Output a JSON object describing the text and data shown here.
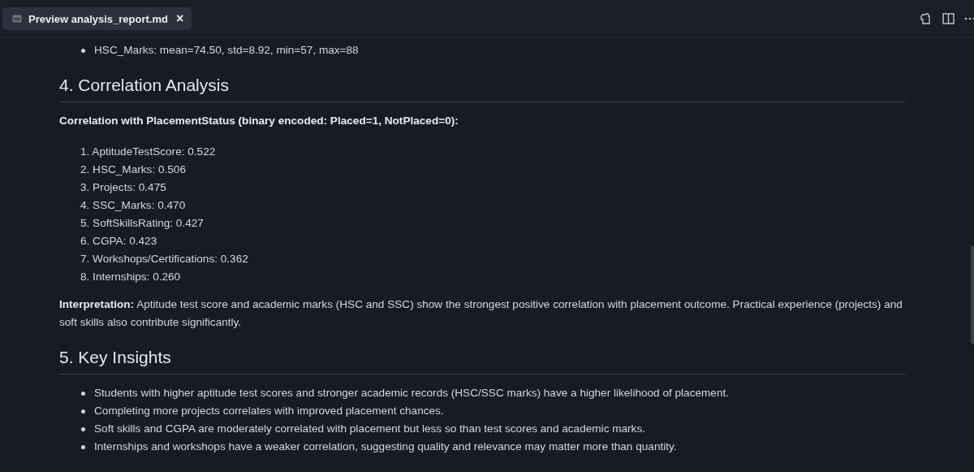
{
  "tabs": [
    {
      "title": "Preview analysis_report.md",
      "close": "×",
      "selected": true
    }
  ],
  "blocks": [
    {
      "kind": "bullets",
      "items": [
        "HSC_Marks: mean=74.50, std=8.92, min=57, max=88"
      ]
    },
    {
      "kind": "heading",
      "text": "4. Correlation Analysis"
    },
    {
      "kind": "paragraph",
      "text": "**Correlation with PlacementStatus (binary encoded: Placed=1, NotPlaced=0):**"
    },
    {
      "kind": "numbered",
      "items": [
        "1. AptitudeTestScore: 0.522",
        "2. HSC_Marks: 0.506",
        "3. Projects: 0.475",
        "4. SSC_Marks: 0.470",
        "5. SoftSkillsRating: 0.427",
        "6. CGPA: 0.423",
        "7. Workshops/Certifications: 0.362",
        "8. Internships: 0.260"
      ]
    },
    {
      "kind": "paragraph",
      "text": "**Interpretation:** Aptitude test score and academic marks (HSC and SSC) show the strongest positive correlation with placement outcome. Practical experience (projects) and soft skills also contribute significantly."
    },
    {
      "kind": "heading",
      "text": "5. Key Insights"
    },
    {
      "kind": "bullets",
      "items": [
        "Students with higher aptitude test scores and stronger academic records (HSC/SSC marks) have a higher likelihood of placement.",
        "Completing more projects correlates with improved placement chances.",
        "Soft skills and CGPA are moderately correlated with placement but less so than test scores and academic marks.",
        "Internships and workshops have a weaker correlation, suggesting quality and relevance may matter more than quantity."
      ]
    }
  ]
}
